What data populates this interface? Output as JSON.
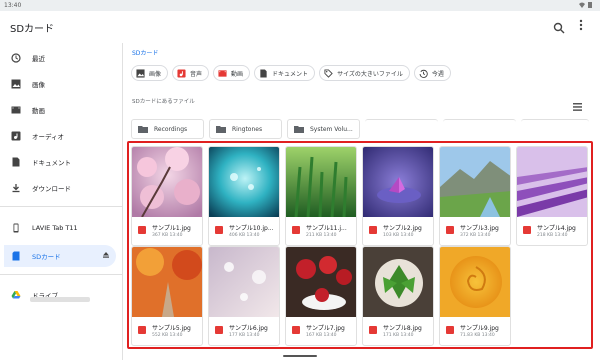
{
  "status": {
    "time": "13:40"
  },
  "appbar": {
    "title": "SDカード"
  },
  "sidebar": {
    "items": [
      {
        "label": "最近",
        "icon": "clock-icon"
      },
      {
        "label": "画像",
        "icon": "image-icon"
      },
      {
        "label": "動画",
        "icon": "video-icon"
      },
      {
        "label": "オーディオ",
        "icon": "audio-icon"
      },
      {
        "label": "ドキュメント",
        "icon": "document-icon"
      },
      {
        "label": "ダウンロード",
        "icon": "download-icon"
      }
    ],
    "devices": [
      {
        "label": "LAVIE Tab T11",
        "icon": "tablet-icon"
      },
      {
        "label": "SDカード",
        "icon": "sdcard-icon"
      },
      {
        "label": "ドライブ",
        "icon": "drive-icon"
      }
    ]
  },
  "main": {
    "breadcrumb": "SDカード",
    "chips": [
      {
        "label": "画像",
        "icon": "image-icon"
      },
      {
        "label": "音声",
        "icon": "audio-icon"
      },
      {
        "label": "動画",
        "icon": "video-icon"
      },
      {
        "label": "ドキュメント",
        "icon": "document-icon"
      },
      {
        "label": "サイズの大きいファイル",
        "icon": "tag-icon"
      },
      {
        "label": "今週",
        "icon": "history-icon"
      }
    ],
    "section_title": "SDカードにあるファイル",
    "folders": [
      "Recordings",
      "Ringtones",
      "System Volu..."
    ],
    "files": [
      {
        "name": "サンプル1.jpg",
        "info": "367 KB 13:40"
      },
      {
        "name": "サンプル10.jp...",
        "info": "406 KB 13:40"
      },
      {
        "name": "サンプル11.j...",
        "info": "211 KB 13:40"
      },
      {
        "name": "サンプル2.jpg",
        "info": "103 KB 13:40"
      },
      {
        "name": "サンプル3.jpg",
        "info": "372 KB 13:40"
      },
      {
        "name": "サンプル4.jpg",
        "info": "218 KB 13:40"
      },
      {
        "name": "サンプル5.jpg",
        "info": "552 KB 13:40"
      },
      {
        "name": "サンプル6.jpg",
        "info": "177 KB 13:40"
      },
      {
        "name": "サンプル7.jpg",
        "info": "167 KB 13:40"
      },
      {
        "name": "サンプル8.jpg",
        "info": "171 KB 13:40"
      },
      {
        "name": "サンプル9.jpg",
        "info": "71.83 KB 13:40"
      }
    ]
  },
  "colors": {
    "accent": "#1a73e8",
    "highlight_box": "#e02020",
    "file_icon": "#e53935"
  }
}
